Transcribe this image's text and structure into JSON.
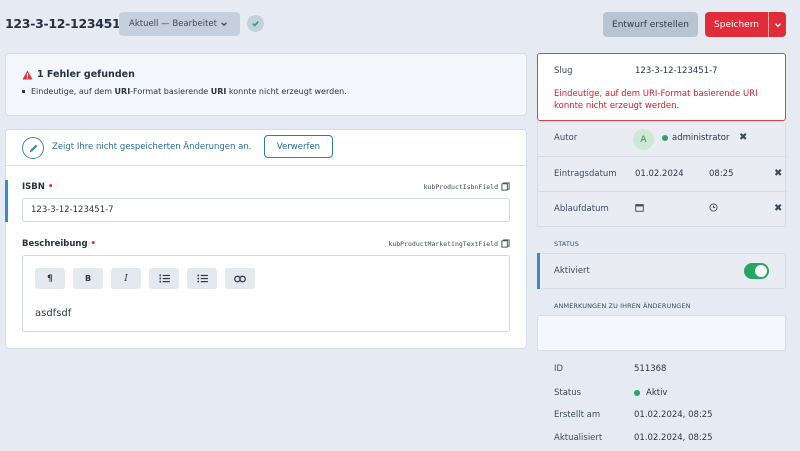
{
  "header": {
    "title": "123-3-12-123451-7",
    "status_pill": "Aktuell — Bearbeitet",
    "draft_button": "Entwurf erstellen",
    "save_button": "Speichern"
  },
  "errors": {
    "heading": "1 Fehler gefunden",
    "item_parts": [
      "Eindeutige, auf dem ",
      "URI",
      "-Format basierende ",
      "URI",
      " konnte nicht erzeugt werden."
    ]
  },
  "unsaved": {
    "text": "Zeigt Ihre nicht gespeicherten Änderungen an.",
    "discard_button": "Verwerfen"
  },
  "fields": {
    "isbn": {
      "label": "ISBN",
      "required_mark": "•",
      "handle": "kubProductIsbnField",
      "value": "123-3-12-123451-7"
    },
    "description": {
      "label": "Beschreibung",
      "required_mark": "•",
      "handle": "kubProductMarketingTextField",
      "value": "asdfsdf"
    }
  },
  "editor_toolbar": [
    "¶",
    "B",
    "I",
    "ordered-list",
    "bullet-list",
    "link"
  ],
  "sidebar": {
    "slug": {
      "label": "Slug",
      "value": "123-3-12-123451-7",
      "error": "Eindeutige, auf dem URI-Format basierende URI konnte nicht erzeugt werden."
    },
    "author": {
      "label": "Autor",
      "avatar_letter": "A",
      "name": "administrator"
    },
    "post_date": {
      "label": "Eintragsdatum",
      "date": "01.02.2024",
      "time": "08:25"
    },
    "expiry_date": {
      "label": "Ablaufdatum"
    },
    "status_heading": "STATUS",
    "enabled": {
      "label": "Aktiviert",
      "on": true
    },
    "notes_heading": "ANMERKUNGEN ZU IHREN ÄNDERUNGEN",
    "notes_value": ""
  },
  "info": {
    "id": {
      "label": "ID",
      "value": "511368"
    },
    "status": {
      "label": "Status",
      "value": "Aktiv"
    },
    "created": {
      "label": "Erstellt am",
      "value": "01.02.2024, 08:25"
    },
    "updated": {
      "label": "Aktualisiert",
      "value": "01.02.2024, 08:25"
    }
  },
  "colors": {
    "danger": "#e12d39",
    "success": "#27a563",
    "link": "#2b7ea6",
    "background": "#e6ebf3"
  }
}
